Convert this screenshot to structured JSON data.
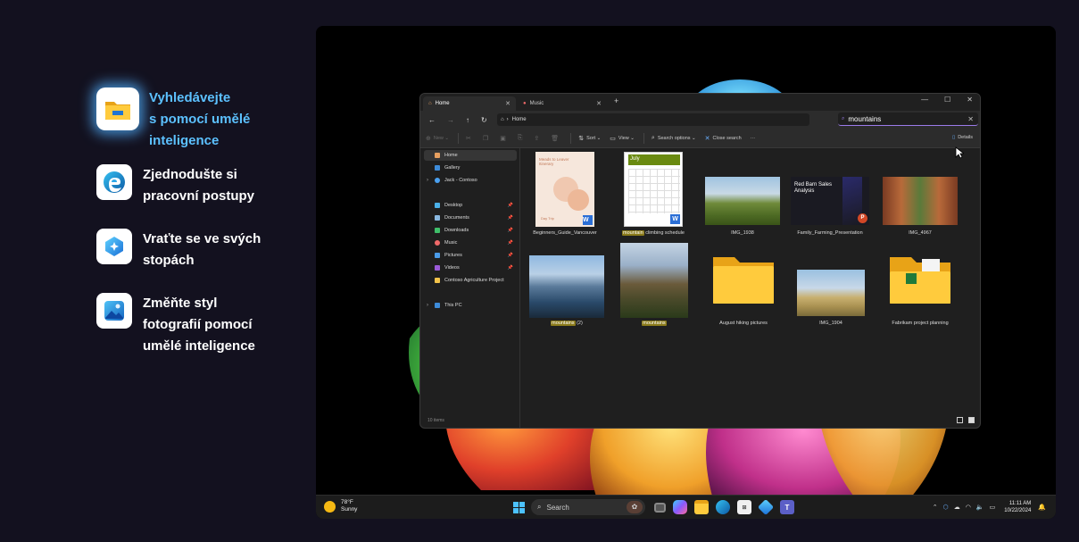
{
  "features": [
    {
      "icon": "file-explorer-icon",
      "label": "Vyhledávejte s pomocí umělé inteligence",
      "line1": "Vyhledávejte",
      "line2": "s pomocí umělé",
      "line3": "inteligence"
    },
    {
      "icon": "edge-icon",
      "line1": "Zjednodušte si",
      "line2": "pracovní postupy"
    },
    {
      "icon": "recall-icon",
      "line1": "Vraťte se ve svých",
      "line2": "stopách"
    },
    {
      "icon": "photos-icon",
      "line1": "Změňte styl",
      "line2": "fotografií pomocí",
      "line3": "umělé inteligence"
    }
  ],
  "explorer": {
    "tabs": [
      {
        "label": "Home"
      },
      {
        "label": "Music"
      }
    ],
    "new_tab": "+",
    "address": "Home",
    "search_value": "mountains",
    "commands": {
      "new": "New",
      "sort": "Sort",
      "view": "View",
      "search_options": "Search options",
      "close_search": "Close search",
      "more": "···",
      "details": "Details"
    },
    "nav": {
      "home": "Home",
      "gallery": "Gallery",
      "jack": "Jack - Contoso",
      "desktop": "Desktop",
      "documents": "Documents",
      "downloads": "Downloads",
      "music": "Music",
      "pictures": "Pictures",
      "videos": "Videos",
      "contoso": "Contoso Agriculture Project",
      "thispc": "This PC"
    },
    "doc1": {
      "title": "Beginners_Guide_Vancouver",
      "heading": "Meads to Leaver Itinerary",
      "footer": "Day Trip"
    },
    "doc2": {
      "hl": "mountain",
      "rest": " climbing schedule",
      "month": "July"
    },
    "img1938": "IMG_1938",
    "ppt": {
      "name": "Family_Farming_Presentation",
      "title": "Red Barn Sales Analysis"
    },
    "img4967": "IMG_4967",
    "mtn2": {
      "hl": "mountains",
      "rest": " (2)"
    },
    "mtn": {
      "hl": "mountains"
    },
    "folder1": "August hiking pictures",
    "img1904": "IMG_1904",
    "folder2": "Fabrikam project planning",
    "status": "10 items"
  },
  "taskbar": {
    "temp": "78°F",
    "condition": "Sunny",
    "search_placeholder": "Search",
    "time": "11:11 AM",
    "date": "10/22/2024"
  }
}
